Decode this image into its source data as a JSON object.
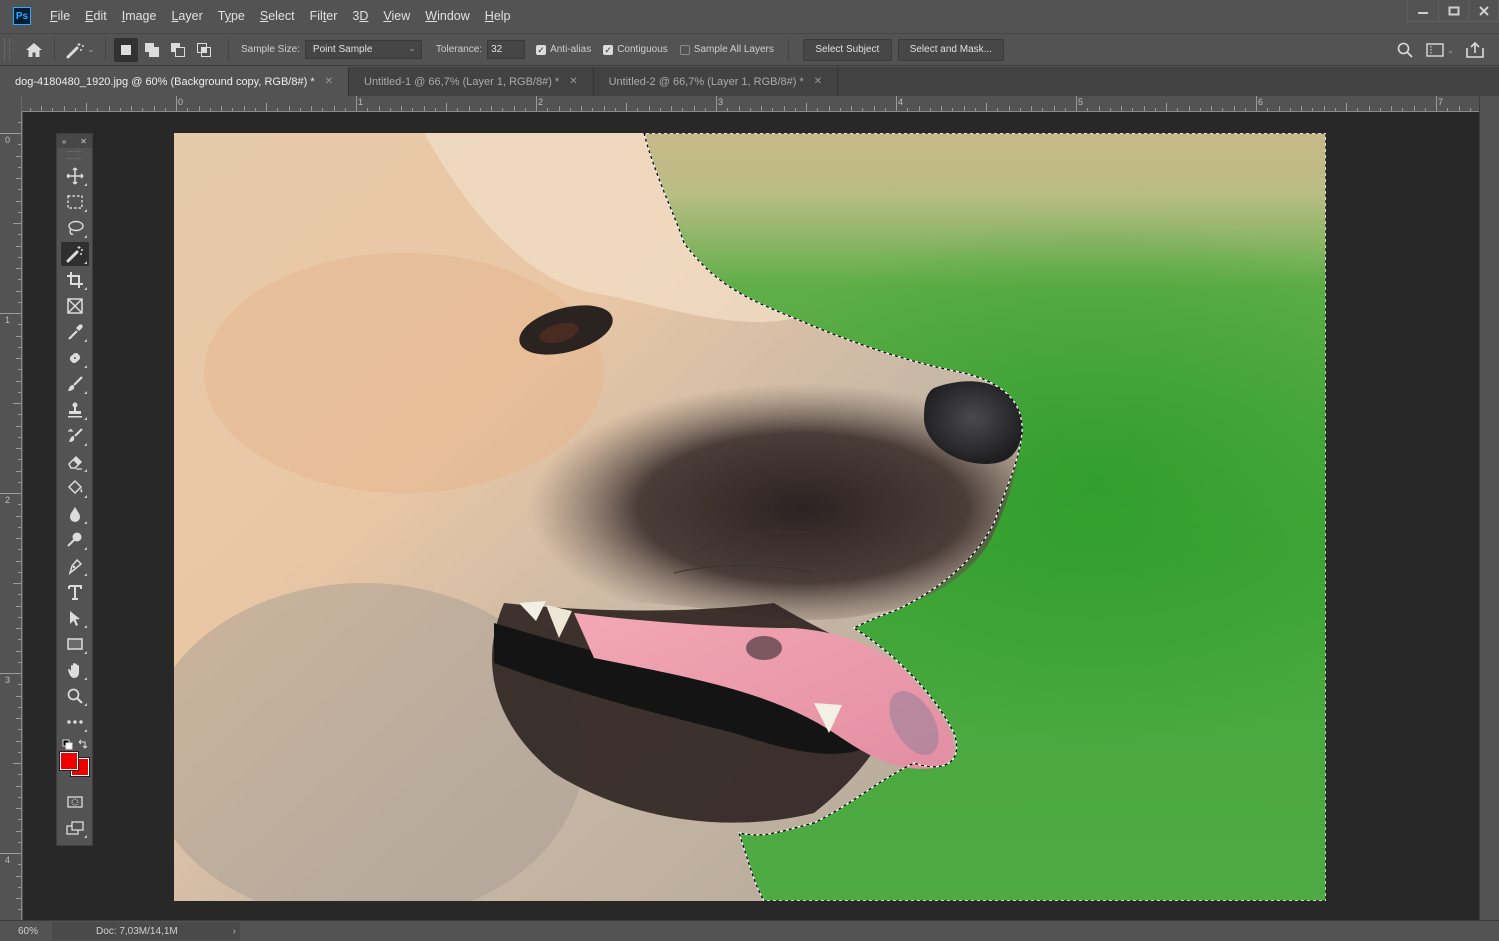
{
  "app": {
    "logo": "Ps",
    "menu": [
      {
        "label": "File",
        "mnemonic": "F",
        "rest": "ile"
      },
      {
        "label": "Edit",
        "mnemonic": "E",
        "rest": "dit"
      },
      {
        "label": "Image",
        "mnemonic": "I",
        "rest": "mage"
      },
      {
        "label": "Layer",
        "mnemonic": "L",
        "rest": "ayer"
      },
      {
        "label": "Type",
        "pre": "T",
        "mnemonic": "y",
        "rest": "pe"
      },
      {
        "label": "Select",
        "mnemonic": "S",
        "rest": "elect"
      },
      {
        "label": "Filter",
        "pre": "Fil",
        "mnemonic": "t",
        "rest": "er"
      },
      {
        "label": "3D",
        "pre": "3",
        "mnemonic": "D",
        "rest": ""
      },
      {
        "label": "View",
        "mnemonic": "V",
        "rest": "iew"
      },
      {
        "label": "Window",
        "mnemonic": "W",
        "rest": "indow"
      },
      {
        "label": "Help",
        "mnemonic": "H",
        "rest": "elp"
      }
    ],
    "window_controls": {
      "minimize": "minimize-icon",
      "maximize": "maximize-icon",
      "close": "close-icon"
    }
  },
  "options_bar": {
    "home_icon": "home-icon",
    "tool_preset_icon": "magic-wand-icon",
    "selection_modes": [
      "new-selection",
      "add-to-selection",
      "subtract-from-selection",
      "intersect-with-selection"
    ],
    "active_mode": "new-selection",
    "sample_size_label": "Sample Size:",
    "sample_size_value": "Point Sample",
    "tolerance_label": "Tolerance:",
    "tolerance_value": "32",
    "anti_alias": {
      "label": "Anti-alias",
      "checked": true
    },
    "contiguous": {
      "label": "Contiguous",
      "checked": true
    },
    "sample_all_layers": {
      "label": "Sample All Layers",
      "checked": false
    },
    "select_subject_label": "Select Subject",
    "select_and_mask_label": "Select and Mask...",
    "right_icons": [
      "search-icon",
      "workspace-icon",
      "share-icon"
    ]
  },
  "tabs": [
    {
      "label": "dog-4180480_1920.jpg @ 60% (Background copy, RGB/8#) *",
      "active": true,
      "close": "✕"
    },
    {
      "label": "Untitled-1 @ 66,7% (Layer 1, RGB/8#) *",
      "active": false,
      "close": "✕"
    },
    {
      "label": "Untitled-2 @ 66,7% (Layer 1, RGB/8#) *",
      "active": false,
      "close": "✕"
    }
  ],
  "rulers": {
    "horizontal_labels": [
      "0",
      "1",
      "2",
      "3",
      "4",
      "5",
      "6",
      "7"
    ],
    "vertical_labels": [
      "0",
      "1",
      "2",
      "3",
      "4"
    ]
  },
  "toolbar": {
    "header_expand": "»",
    "header_close": "✕",
    "tools": [
      {
        "name": "move-tool",
        "label": "Move Tool"
      },
      {
        "name": "rectangular-marquee-tool",
        "label": "Rectangular Marquee Tool"
      },
      {
        "name": "lasso-tool",
        "label": "Lasso Tool"
      },
      {
        "name": "magic-wand-tool",
        "label": "Magic Wand Tool",
        "active": true
      },
      {
        "name": "crop-tool",
        "label": "Crop Tool"
      },
      {
        "name": "frame-tool",
        "label": "Frame Tool"
      },
      {
        "name": "eyedropper-tool",
        "label": "Eyedropper Tool"
      },
      {
        "name": "healing-brush-tool",
        "label": "Spot Healing Brush Tool"
      },
      {
        "name": "brush-tool",
        "label": "Brush Tool"
      },
      {
        "name": "clone-stamp-tool",
        "label": "Clone Stamp Tool"
      },
      {
        "name": "history-brush-tool",
        "label": "History Brush Tool"
      },
      {
        "name": "eraser-tool",
        "label": "Eraser Tool"
      },
      {
        "name": "paint-bucket-tool",
        "label": "Paint Bucket Tool"
      },
      {
        "name": "blur-tool",
        "label": "Blur Tool"
      },
      {
        "name": "dodge-tool",
        "label": "Dodge Tool"
      },
      {
        "name": "pen-tool",
        "label": "Pen Tool"
      },
      {
        "name": "type-tool",
        "label": "Horizontal Type Tool"
      },
      {
        "name": "path-selection-tool",
        "label": "Path Selection Tool"
      },
      {
        "name": "rectangle-tool",
        "label": "Rectangle Tool"
      },
      {
        "name": "hand-tool",
        "label": "Hand Tool"
      },
      {
        "name": "zoom-tool",
        "label": "Zoom Tool"
      },
      {
        "name": "edit-toolbar",
        "label": "Edit Toolbar"
      }
    ],
    "foreground_color": "#ee0000",
    "background_color": "#ee0000",
    "quick_mask_icon": "quick-mask-icon",
    "screen_mode_icon": "screen-mode-icon"
  },
  "status_bar": {
    "zoom": "60%",
    "doc_info": "Doc: 7,03M/14,1M",
    "arrow": "›"
  },
  "colors": {
    "ui_bg": "#535353",
    "pasteboard": "#282828",
    "tab_inactive": "#424242",
    "ps_accent": "#31a8ff"
  }
}
